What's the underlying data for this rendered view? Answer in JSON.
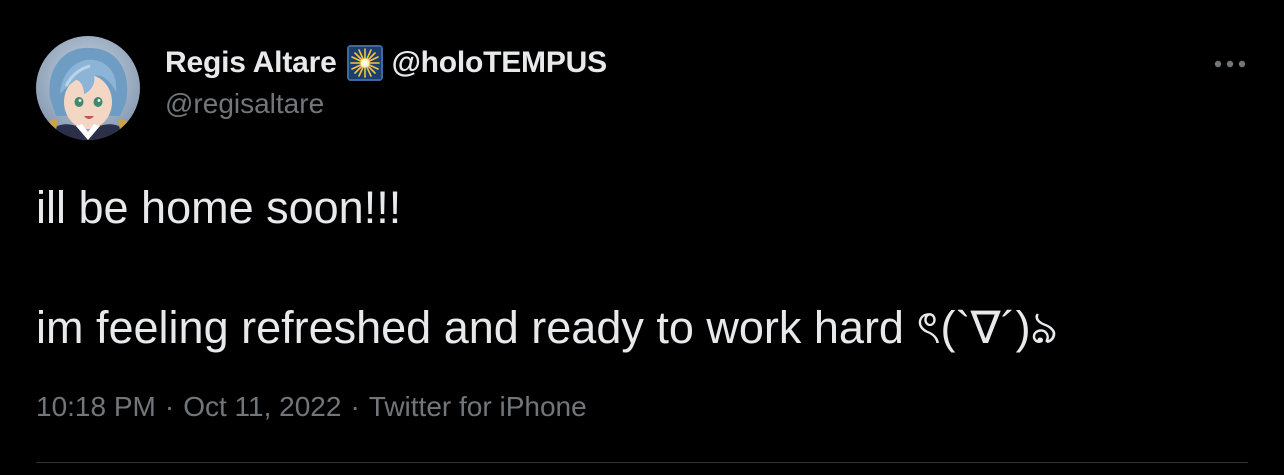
{
  "tweet": {
    "author": {
      "display_name": "Regis Altare",
      "affiliation_handle": "@holoTEMPUS",
      "username": "@regisaltare",
      "avatar_icon": "avatar-icon",
      "affiliation_badge_icon": "affiliation-badge-icon"
    },
    "more_icon": "more-horizontal-icon",
    "text": {
      "line1": "ill be home soon!!!",
      "line2": "im feeling refreshed and ready to work hard ৎ(`∇´)ঌ"
    },
    "meta": {
      "time": "10:18 PM",
      "date": "Oct 11, 2022",
      "source": "Twitter for iPhone",
      "separator": "·"
    }
  },
  "colors": {
    "background": "#000000",
    "primary_text": "#e7e9ea",
    "secondary_text": "#71767b",
    "divider": "#2f3336",
    "badge_background": "#1c3f6e",
    "badge_burst": "#f5c542"
  }
}
